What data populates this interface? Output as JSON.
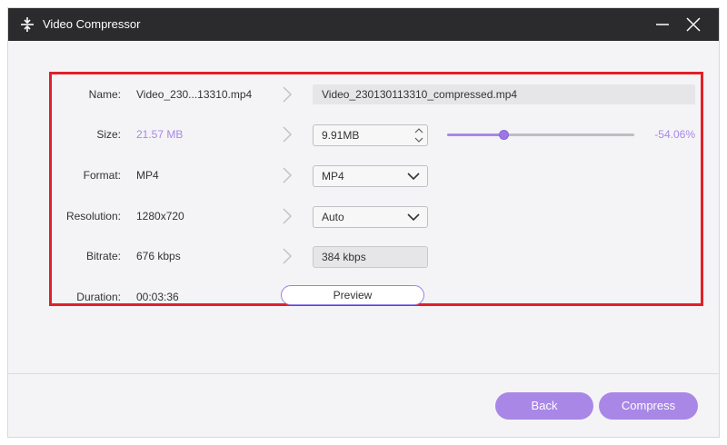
{
  "window": {
    "title": "Video Compressor",
    "icon": "compress-icon"
  },
  "fields": {
    "name": {
      "label": "Name:",
      "source": "Video_230...13310.mp4",
      "output": "Video_230130113310_compressed.mp4"
    },
    "size": {
      "label": "Size:",
      "source": "21.57 MB",
      "output": "9.91MB",
      "percent": "-54.06%",
      "slider_level": 0.3
    },
    "format": {
      "label": "Format:",
      "source": "MP4",
      "selected": "MP4"
    },
    "resolution": {
      "label": "Resolution:",
      "source": "1280x720",
      "selected": "Auto"
    },
    "bitrate": {
      "label": "Bitrate:",
      "source": "676 kbps",
      "output": "384 kbps"
    },
    "duration": {
      "label": "Duration:",
      "source": "00:03:36"
    }
  },
  "buttons": {
    "preview": "Preview",
    "back": "Back",
    "compress": "Compress"
  },
  "colors": {
    "accent": "#a987e6",
    "highlight_border": "#e0202b",
    "titlebar": "#2b2b2e"
  }
}
